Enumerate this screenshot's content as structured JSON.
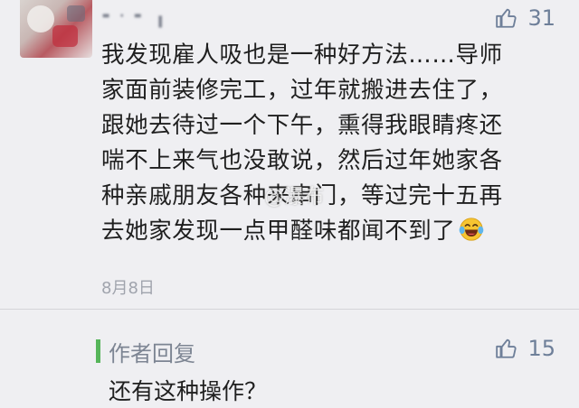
{
  "comment": {
    "username": "╸·╺ ╻",
    "like_count": "31",
    "lines": [
      "我发现雇人吸也是一种好方法……导师",
      "家面前装修完工，过年就搬进去住了，",
      "跟她去待过一个下午，熏得我眼睛疼还",
      "喘不上来气也没敢说，然后过年她家各",
      "种亲戚朋友各种来串门，等过完十五再",
      "去她家发现一点甲醛味都闻不到了"
    ],
    "emoji": "laughing-tears-emoji",
    "date": "8月8日",
    "watermark": "@瀑布"
  },
  "author_reply": {
    "label": "作者回复",
    "like_count": "15",
    "text": "还有这种操作？"
  },
  "colors": {
    "background": "#efeff2",
    "like": "#6e7f99",
    "author_bar": "#56b55a",
    "meta_text": "#a0a4ad"
  }
}
